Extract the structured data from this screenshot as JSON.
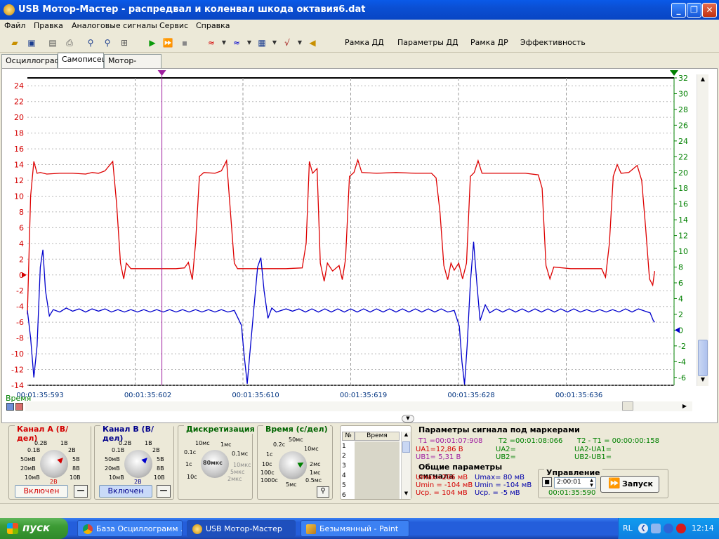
{
  "window": {
    "title": "USB Мотор-Мастер - распредвал и коленвал шкода октавия6.dat"
  },
  "menu": [
    "Файл",
    "Правка",
    "Аналоговые сигналы",
    "Сервис",
    "Справка"
  ],
  "toolbar": {
    "text_buttons": [
      "Рамка ДД",
      "Параметры ДД",
      "Рамка ДР",
      "Эффективность"
    ]
  },
  "tabs": [
    {
      "label": "Осциллограф",
      "active": false
    },
    {
      "label": "Самописец",
      "active": true
    },
    {
      "label": "Мотор-тестер",
      "active": false
    }
  ],
  "scope": {
    "time_label": "Время",
    "time_ticks": [
      "00:01:35:593",
      "00:01:35:602",
      "00:01:35:610",
      "00:01:35:619",
      "00:01:35:628",
      "00:01:35:636"
    ]
  },
  "chart_data": {
    "type": "line",
    "left_axis": {
      "ticks": [
        24,
        22,
        20,
        18,
        16,
        14,
        12,
        10,
        8,
        6,
        4,
        2,
        0,
        -2,
        -4,
        -6,
        -8,
        -10,
        -12,
        -14
      ],
      "color": "#d40000"
    },
    "right_axis": {
      "ticks": [
        32,
        30,
        28,
        26,
        24,
        22,
        20,
        18,
        16,
        14,
        12,
        10,
        8,
        6,
        4,
        2,
        0,
        -2,
        -4,
        -6
      ],
      "color": "#008000"
    },
    "ylim_left": [
      -14,
      25
    ],
    "ylim_right": [
      -7,
      32
    ],
    "xlim": [
      0,
      100
    ],
    "grid": true,
    "markers": {
      "t1_x": 20.8,
      "t1_color": "#a020a0",
      "t2_color": "#008000"
    },
    "series": [
      {
        "color": "#dd0000",
        "axis": "left",
        "points": [
          [
            0,
            -5
          ],
          [
            0.5,
            10
          ],
          [
            1,
            14.4
          ],
          [
            1.5,
            12.9
          ],
          [
            2,
            13.0
          ],
          [
            3,
            12.8
          ],
          [
            5,
            12.9
          ],
          [
            7,
            12.9
          ],
          [
            9,
            12.8
          ],
          [
            10,
            13.0
          ],
          [
            11,
            12.9
          ],
          [
            12,
            13.2
          ],
          [
            13.2,
            14.4
          ],
          [
            13.8,
            9
          ],
          [
            14.4,
            1.5
          ],
          [
            14.9,
            -0.5
          ],
          [
            15.3,
            1.5
          ],
          [
            16,
            0.8
          ],
          [
            18,
            0.8
          ],
          [
            21,
            0.8
          ],
          [
            23,
            0.8
          ],
          [
            24.3,
            0.9
          ],
          [
            24.9,
            1.6
          ],
          [
            25.5,
            -0.6
          ],
          [
            26,
            4
          ],
          [
            26.6,
            12.5
          ],
          [
            27.3,
            13.0
          ],
          [
            29,
            12.9
          ],
          [
            30,
            13.2
          ],
          [
            30.8,
            14.5
          ],
          [
            31.4,
            8
          ],
          [
            32,
            1.5
          ],
          [
            32.5,
            0.8
          ],
          [
            36,
            0.8
          ],
          [
            40,
            0.8
          ],
          [
            42.5,
            0.9
          ],
          [
            43.1,
            4
          ],
          [
            43.6,
            14.4
          ],
          [
            44.1,
            12.9
          ],
          [
            44.8,
            13.5
          ],
          [
            45.3,
            1.5
          ],
          [
            45.9,
            -0.8
          ],
          [
            46.4,
            1.5
          ],
          [
            47.2,
            0.5
          ],
          [
            48.2,
            1.2
          ],
          [
            48.7,
            -0.6
          ],
          [
            49.2,
            2
          ],
          [
            49.8,
            12.5
          ],
          [
            50.5,
            13.0
          ],
          [
            51.1,
            14.6
          ],
          [
            51.7,
            13.0
          ],
          [
            54,
            12.9
          ],
          [
            57,
            13.0
          ],
          [
            60,
            12.9
          ],
          [
            62.5,
            12.9
          ],
          [
            63.2,
            12.3
          ],
          [
            63.8,
            8
          ],
          [
            64.4,
            1.2
          ],
          [
            65,
            -0.6
          ],
          [
            65.5,
            1.5
          ],
          [
            66,
            0.6
          ],
          [
            66.7,
            1.5
          ],
          [
            67.3,
            -0.5
          ],
          [
            67.9,
            1.5
          ],
          [
            68.5,
            12.5
          ],
          [
            69.1,
            13.0
          ],
          [
            69.7,
            14.5
          ],
          [
            70.3,
            12.9
          ],
          [
            74,
            12.9
          ],
          [
            77,
            12.9
          ],
          [
            79,
            12.7
          ],
          [
            79.6,
            11
          ],
          [
            80.2,
            1.2
          ],
          [
            80.8,
            -0.5
          ],
          [
            81.4,
            1.0
          ],
          [
            84,
            0.8
          ],
          [
            87,
            0.8
          ],
          [
            88.8,
            0.8
          ],
          [
            89.4,
            -0.3
          ],
          [
            90,
            4
          ],
          [
            90.6,
            12.5
          ],
          [
            91.2,
            14.0
          ],
          [
            91.8,
            12.9
          ],
          [
            93,
            13.0
          ],
          [
            94.3,
            13.9
          ],
          [
            95,
            12.0
          ],
          [
            95.6,
            6
          ],
          [
            96.2,
            -0.5
          ],
          [
            96.7,
            -1.3
          ],
          [
            97,
            0.5
          ]
        ]
      },
      {
        "color": "#0000cc",
        "axis": "right",
        "points": [
          [
            0,
            2.5
          ],
          [
            0.5,
            -1
          ],
          [
            1,
            -6
          ],
          [
            1.5,
            -2
          ],
          [
            2,
            8
          ],
          [
            2.4,
            10.2
          ],
          [
            2.8,
            5
          ],
          [
            3.4,
            1.8
          ],
          [
            4,
            2.6
          ],
          [
            5,
            2.3
          ],
          [
            6,
            2.8
          ],
          [
            7,
            2.4
          ],
          [
            8,
            2.7
          ],
          [
            9,
            2.3
          ],
          [
            10,
            2.7
          ],
          [
            11,
            2.4
          ],
          [
            12,
            2.7
          ],
          [
            13,
            2.3
          ],
          [
            14,
            2.6
          ],
          [
            15,
            2.3
          ],
          [
            16,
            2.6
          ],
          [
            17,
            2.3
          ],
          [
            18,
            2.6
          ],
          [
            19,
            2.3
          ],
          [
            20,
            2.6
          ],
          [
            21,
            2.3
          ],
          [
            22,
            2.6
          ],
          [
            23,
            2.3
          ],
          [
            24,
            2.6
          ],
          [
            25,
            2.3
          ],
          [
            26,
            2.6
          ],
          [
            27,
            2.3
          ],
          [
            28,
            2.6
          ],
          [
            29,
            2.3
          ],
          [
            30,
            2.6
          ],
          [
            31,
            2.3
          ],
          [
            32,
            2.5
          ],
          [
            33.1,
            0.6
          ],
          [
            33.5,
            -3
          ],
          [
            34,
            -6.8
          ],
          [
            34.4,
            -3
          ],
          [
            35,
            2.5
          ],
          [
            35.6,
            8
          ],
          [
            36.1,
            9.2
          ],
          [
            36.6,
            5
          ],
          [
            37.2,
            1.5
          ],
          [
            37.8,
            2.8
          ],
          [
            38.5,
            2.3
          ],
          [
            40,
            2.7
          ],
          [
            41,
            2.4
          ],
          [
            42,
            2.7
          ],
          [
            43,
            2.3
          ],
          [
            44,
            2.7
          ],
          [
            45,
            2.3
          ],
          [
            46,
            2.7
          ],
          [
            47,
            2.3
          ],
          [
            48,
            2.7
          ],
          [
            49,
            2.3
          ],
          [
            50,
            2.7
          ],
          [
            51,
            2.3
          ],
          [
            52,
            2.7
          ],
          [
            53,
            2.3
          ],
          [
            54,
            2.7
          ],
          [
            55,
            2.3
          ],
          [
            56,
            2.7
          ],
          [
            57,
            2.3
          ],
          [
            58,
            2.7
          ],
          [
            59,
            2.3
          ],
          [
            60,
            2.7
          ],
          [
            61,
            2.3
          ],
          [
            62,
            2.7
          ],
          [
            63,
            2.3
          ],
          [
            64,
            2.7
          ],
          [
            65,
            2.3
          ],
          [
            66,
            2.5
          ],
          [
            66.8,
            0.5
          ],
          [
            67.2,
            -4
          ],
          [
            67.6,
            -6.9
          ],
          [
            68,
            -2
          ],
          [
            68.5,
            6
          ],
          [
            69,
            11.2
          ],
          [
            69.5,
            6
          ],
          [
            70,
            1.2
          ],
          [
            70.8,
            3.2
          ],
          [
            71.5,
            2.2
          ],
          [
            72.5,
            2.7
          ],
          [
            73.5,
            2.3
          ],
          [
            74.5,
            2.7
          ],
          [
            75.5,
            2.3
          ],
          [
            76.5,
            2.7
          ],
          [
            77.5,
            2.3
          ],
          [
            78.5,
            2.7
          ],
          [
            79.5,
            2.3
          ],
          [
            80.5,
            2.7
          ],
          [
            81.5,
            2.3
          ],
          [
            82.5,
            2.7
          ],
          [
            83.5,
            2.3
          ],
          [
            84.5,
            2.7
          ],
          [
            85.5,
            2.3
          ],
          [
            86.5,
            2.6
          ],
          [
            87.5,
            2.3
          ],
          [
            88.5,
            2.6
          ],
          [
            89.5,
            2.3
          ],
          [
            90.5,
            2.6
          ],
          [
            91.5,
            2.3
          ],
          [
            92.5,
            2.7
          ],
          [
            93.5,
            2.3
          ],
          [
            94.5,
            2.7
          ],
          [
            95.5,
            2.4
          ],
          [
            96.3,
            2.2
          ],
          [
            96.8,
            1.2
          ],
          [
            97,
            1.0
          ]
        ]
      }
    ]
  },
  "bottom": {
    "channel_a": {
      "title": "Канал А (В/дел)",
      "color": "#d40000",
      "dial": [
        "0.2В",
        "1В",
        "0.1В",
        "2В",
        "50мВ",
        "5В",
        "20мВ",
        "8В",
        "10мВ",
        "10В",
        "2В"
      ],
      "status": "Включен",
      "minus": "—"
    },
    "channel_b": {
      "title": "Канал В (В/дел)",
      "color": "#00008b",
      "dial": [
        "0.2В",
        "1В",
        "0.1В",
        "2В",
        "50мВ",
        "5В",
        "20мВ",
        "8В",
        "10мВ",
        "10В",
        "2В"
      ],
      "status": "Включен",
      "minus": "—"
    },
    "sampling": {
      "title": "Дискретизация",
      "dial": [
        "10мс",
        "1мс",
        "0.1с",
        "0.1мс",
        "1с",
        "10мкс",
        "10с",
        "5мкс",
        "2мкс"
      ],
      "value": "80мкс"
    },
    "time": {
      "title": "Время (с/дел)",
      "dial": [
        "50мс",
        "0.2с",
        "10мс",
        "1с",
        "2мс",
        "10с",
        "100с",
        "1мс",
        "1000с",
        "0.5мс",
        "5мс"
      ]
    },
    "table": {
      "headers": [
        "№",
        "Время"
      ],
      "rows": [
        "1",
        "2",
        "3",
        "4",
        "5",
        "6"
      ]
    },
    "marker_params": {
      "title": "Параметры сигнала под маркерами",
      "t1": "T1 =00:01:07:908",
      "t2": "T2 =00:01:08:066",
      "dt": "T2 - T1 = 00:00:00:158",
      "ua1": "UА1=12,86 В",
      "ub1": "UВ1= 5,31 В",
      "ua2": "UА2=",
      "ub2": "UВ2=",
      "dua": "UА2-UА1=",
      "dub": "UВ2-UВ1="
    },
    "general_params": {
      "title": "Общие параметры сигнала",
      "a_max": "Umax=206 мВ",
      "a_min": "Umin = -104 мВ",
      "a_avg": "Uср. = 104 мВ",
      "b_max": "Umax= 80 мВ",
      "b_min": "Umin = -104 мВ",
      "b_avg": "Uср. = -5 мВ"
    },
    "control": {
      "title": "Управление",
      "spin_value": "2:00:01",
      "time_readout": "00:01:35:590",
      "run_label": "Запуск"
    }
  },
  "taskbar": {
    "start_label": "пуск",
    "tasks": [
      {
        "label": "База Осциллограмм ...",
        "active": false
      },
      {
        "label": "USB Мотор-Мастер",
        "active": true
      },
      {
        "label": "Безымянный - Paint",
        "active": false
      }
    ],
    "lang": "RL",
    "clock": "12:14"
  }
}
